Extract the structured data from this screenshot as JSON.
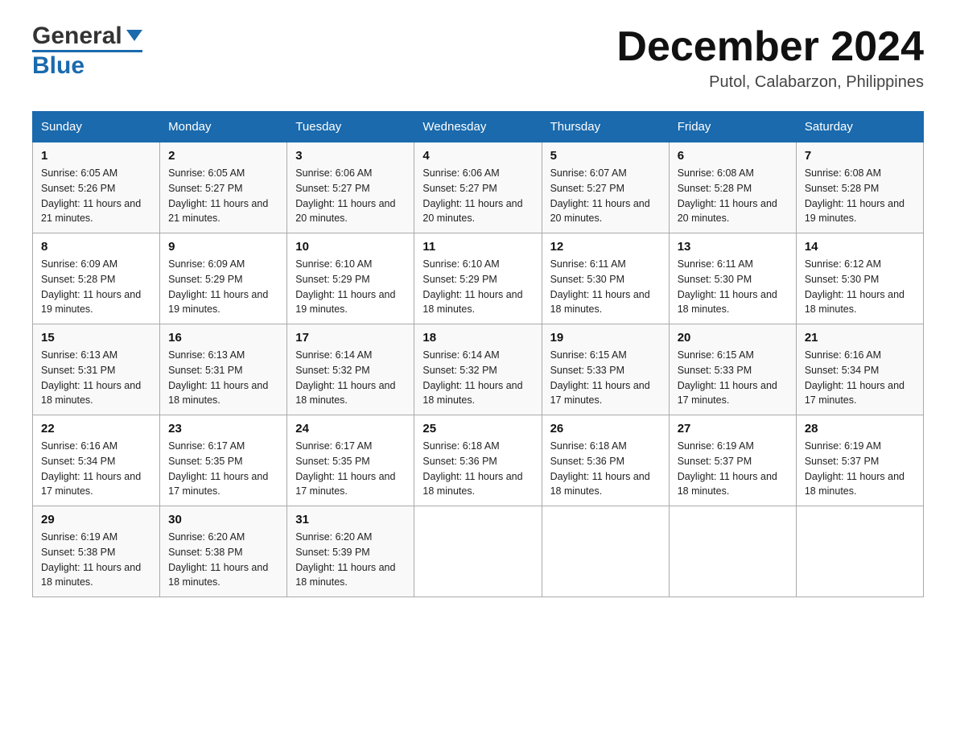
{
  "header": {
    "logo_general": "General",
    "logo_blue": "Blue",
    "month_title": "December 2024",
    "location": "Putol, Calabarzon, Philippines"
  },
  "days_of_week": [
    "Sunday",
    "Monday",
    "Tuesday",
    "Wednesday",
    "Thursday",
    "Friday",
    "Saturday"
  ],
  "weeks": [
    [
      {
        "day": "1",
        "sunrise": "6:05 AM",
        "sunset": "5:26 PM",
        "daylight": "11 hours and 21 minutes."
      },
      {
        "day": "2",
        "sunrise": "6:05 AM",
        "sunset": "5:27 PM",
        "daylight": "11 hours and 21 minutes."
      },
      {
        "day": "3",
        "sunrise": "6:06 AM",
        "sunset": "5:27 PM",
        "daylight": "11 hours and 20 minutes."
      },
      {
        "day": "4",
        "sunrise": "6:06 AM",
        "sunset": "5:27 PM",
        "daylight": "11 hours and 20 minutes."
      },
      {
        "day": "5",
        "sunrise": "6:07 AM",
        "sunset": "5:27 PM",
        "daylight": "11 hours and 20 minutes."
      },
      {
        "day": "6",
        "sunrise": "6:08 AM",
        "sunset": "5:28 PM",
        "daylight": "11 hours and 20 minutes."
      },
      {
        "day": "7",
        "sunrise": "6:08 AM",
        "sunset": "5:28 PM",
        "daylight": "11 hours and 19 minutes."
      }
    ],
    [
      {
        "day": "8",
        "sunrise": "6:09 AM",
        "sunset": "5:28 PM",
        "daylight": "11 hours and 19 minutes."
      },
      {
        "day": "9",
        "sunrise": "6:09 AM",
        "sunset": "5:29 PM",
        "daylight": "11 hours and 19 minutes."
      },
      {
        "day": "10",
        "sunrise": "6:10 AM",
        "sunset": "5:29 PM",
        "daylight": "11 hours and 19 minutes."
      },
      {
        "day": "11",
        "sunrise": "6:10 AM",
        "sunset": "5:29 PM",
        "daylight": "11 hours and 18 minutes."
      },
      {
        "day": "12",
        "sunrise": "6:11 AM",
        "sunset": "5:30 PM",
        "daylight": "11 hours and 18 minutes."
      },
      {
        "day": "13",
        "sunrise": "6:11 AM",
        "sunset": "5:30 PM",
        "daylight": "11 hours and 18 minutes."
      },
      {
        "day": "14",
        "sunrise": "6:12 AM",
        "sunset": "5:30 PM",
        "daylight": "11 hours and 18 minutes."
      }
    ],
    [
      {
        "day": "15",
        "sunrise": "6:13 AM",
        "sunset": "5:31 PM",
        "daylight": "11 hours and 18 minutes."
      },
      {
        "day": "16",
        "sunrise": "6:13 AM",
        "sunset": "5:31 PM",
        "daylight": "11 hours and 18 minutes."
      },
      {
        "day": "17",
        "sunrise": "6:14 AM",
        "sunset": "5:32 PM",
        "daylight": "11 hours and 18 minutes."
      },
      {
        "day": "18",
        "sunrise": "6:14 AM",
        "sunset": "5:32 PM",
        "daylight": "11 hours and 18 minutes."
      },
      {
        "day": "19",
        "sunrise": "6:15 AM",
        "sunset": "5:33 PM",
        "daylight": "11 hours and 17 minutes."
      },
      {
        "day": "20",
        "sunrise": "6:15 AM",
        "sunset": "5:33 PM",
        "daylight": "11 hours and 17 minutes."
      },
      {
        "day": "21",
        "sunrise": "6:16 AM",
        "sunset": "5:34 PM",
        "daylight": "11 hours and 17 minutes."
      }
    ],
    [
      {
        "day": "22",
        "sunrise": "6:16 AM",
        "sunset": "5:34 PM",
        "daylight": "11 hours and 17 minutes."
      },
      {
        "day": "23",
        "sunrise": "6:17 AM",
        "sunset": "5:35 PM",
        "daylight": "11 hours and 17 minutes."
      },
      {
        "day": "24",
        "sunrise": "6:17 AM",
        "sunset": "5:35 PM",
        "daylight": "11 hours and 17 minutes."
      },
      {
        "day": "25",
        "sunrise": "6:18 AM",
        "sunset": "5:36 PM",
        "daylight": "11 hours and 18 minutes."
      },
      {
        "day": "26",
        "sunrise": "6:18 AM",
        "sunset": "5:36 PM",
        "daylight": "11 hours and 18 minutes."
      },
      {
        "day": "27",
        "sunrise": "6:19 AM",
        "sunset": "5:37 PM",
        "daylight": "11 hours and 18 minutes."
      },
      {
        "day": "28",
        "sunrise": "6:19 AM",
        "sunset": "5:37 PM",
        "daylight": "11 hours and 18 minutes."
      }
    ],
    [
      {
        "day": "29",
        "sunrise": "6:19 AM",
        "sunset": "5:38 PM",
        "daylight": "11 hours and 18 minutes."
      },
      {
        "day": "30",
        "sunrise": "6:20 AM",
        "sunset": "5:38 PM",
        "daylight": "11 hours and 18 minutes."
      },
      {
        "day": "31",
        "sunrise": "6:20 AM",
        "sunset": "5:39 PM",
        "daylight": "11 hours and 18 minutes."
      },
      null,
      null,
      null,
      null
    ]
  ]
}
